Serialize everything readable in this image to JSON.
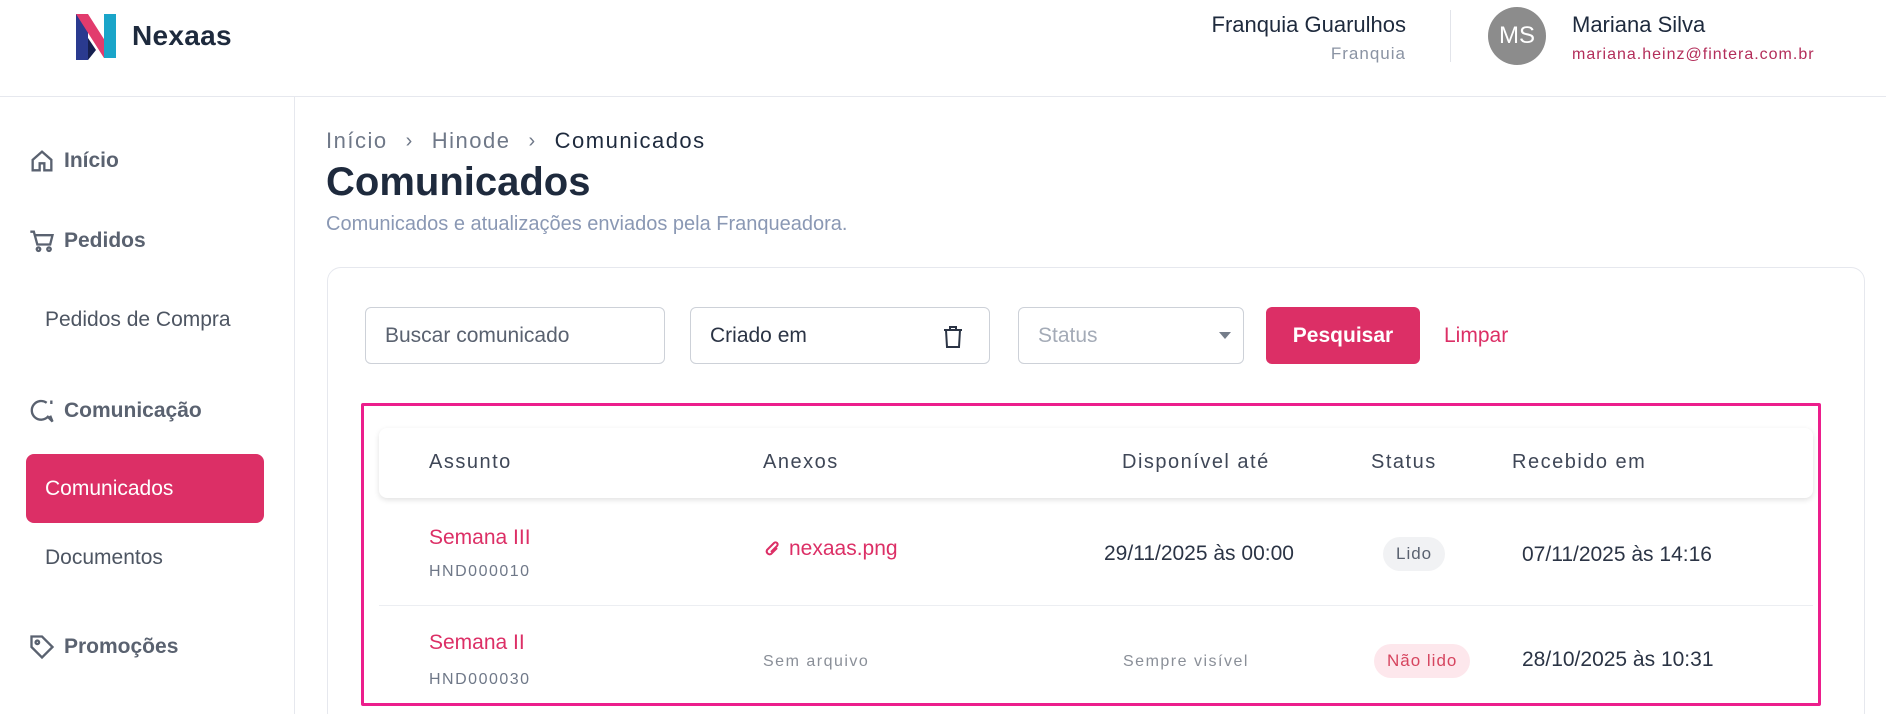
{
  "header": {
    "brand": "Nexaas",
    "franchise_name": "Franquia Guarulhos",
    "franchise_type": "Franquia",
    "user_initials": "MS",
    "user_name": "Mariana Silva",
    "user_email": "mariana.heinz@fintera.com.br"
  },
  "sidebar": {
    "inicio": "Início",
    "pedidos": "Pedidos",
    "pedidos_compra": "Pedidos de Compra",
    "comunicacao": "Comunicação",
    "comunicados": "Comunicados",
    "documentos": "Documentos",
    "promocoes": "Promoções"
  },
  "breadcrumb": [
    "Início",
    "Hinode",
    "Comunicados"
  ],
  "page": {
    "title": "Comunicados",
    "subtitle": "Comunicados e atualizações enviados pela Franqueadora."
  },
  "filters": {
    "search_placeholder": "Buscar comunicado",
    "date_placeholder": "Criado em",
    "status_placeholder": "Status",
    "search_button": "Pesquisar",
    "clear_button": "Limpar"
  },
  "table": {
    "headers": [
      "Assunto",
      "Anexos",
      "Disponível até",
      "Status",
      "Recebido em"
    ],
    "rows": [
      {
        "subject": "Semana III",
        "code": "HND000010",
        "attachment": "nexaas.png",
        "available_until": "29/11/2025 às 00:00",
        "status": "Lido",
        "received_at": "07/11/2025 às 14:16"
      },
      {
        "subject": "Semana II",
        "code": "HND000030",
        "attachment": "Sem arquivo",
        "available_until": "Sempre visível",
        "status": "Não lido",
        "received_at": "28/10/2025 às 10:31"
      }
    ]
  },
  "colors": {
    "accent": "#dc2f66",
    "highlight_border": "#ec1e8c"
  }
}
